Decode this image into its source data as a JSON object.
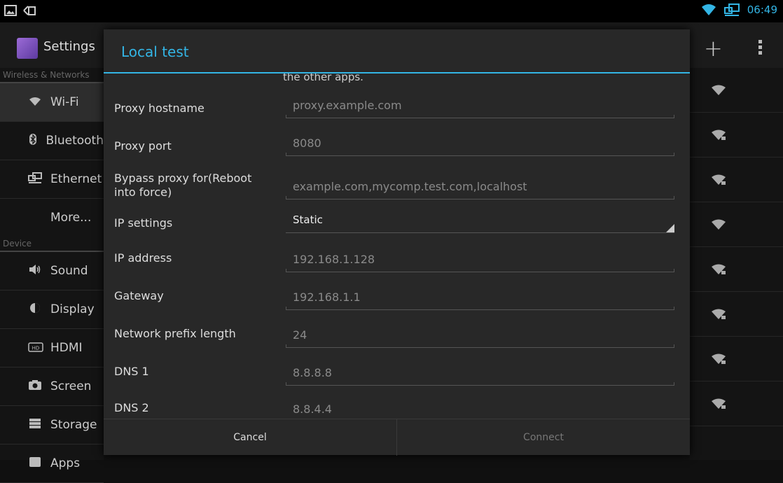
{
  "status_bar": {
    "time": "06:49"
  },
  "action_bar": {
    "title": "Settings"
  },
  "sidebar": {
    "section_wireless": "Wireless & Networks",
    "section_device": "Device",
    "items": [
      {
        "label": "Wi-Fi",
        "icon": "wifi-icon"
      },
      {
        "label": "Bluetooth",
        "icon": "bluetooth-icon"
      },
      {
        "label": "Ethernet",
        "icon": "ethernet-icon"
      },
      {
        "label": "More...",
        "icon": ""
      },
      {
        "label": "Sound",
        "icon": "sound-icon"
      },
      {
        "label": "Display",
        "icon": "display-icon"
      },
      {
        "label": "HDMI",
        "icon": "hdmi-icon"
      },
      {
        "label": "Screen",
        "icon": "screenshot-icon"
      },
      {
        "label": "Storage",
        "icon": "storage-icon"
      },
      {
        "label": "Apps",
        "icon": "apps-icon"
      }
    ]
  },
  "dialog": {
    "title": "Local test",
    "previous_text": "the other apps.",
    "fields": {
      "proxy_hostname": {
        "label": "Proxy hostname",
        "placeholder": "proxy.example.com"
      },
      "proxy_port": {
        "label": "Proxy port",
        "placeholder": "8080"
      },
      "bypass": {
        "label": "Bypass proxy for(Reboot into force)",
        "placeholder": "example.com,mycomp.test.com,localhost"
      },
      "ip_settings": {
        "label": "IP settings",
        "value": "Static"
      },
      "ip_address": {
        "label": "IP address",
        "placeholder": "192.168.1.128"
      },
      "gateway": {
        "label": "Gateway",
        "placeholder": "192.168.1.1"
      },
      "prefix": {
        "label": "Network prefix length",
        "placeholder": "24"
      },
      "dns1": {
        "label": "DNS 1",
        "placeholder": "8.8.8.8"
      },
      "dns2": {
        "label": "DNS 2",
        "placeholder": "8.8.4.4"
      }
    },
    "buttons": {
      "cancel": "Cancel",
      "connect": "Connect"
    }
  },
  "colors": {
    "accent": "#33b5e5",
    "dialog_bg": "#282828"
  }
}
